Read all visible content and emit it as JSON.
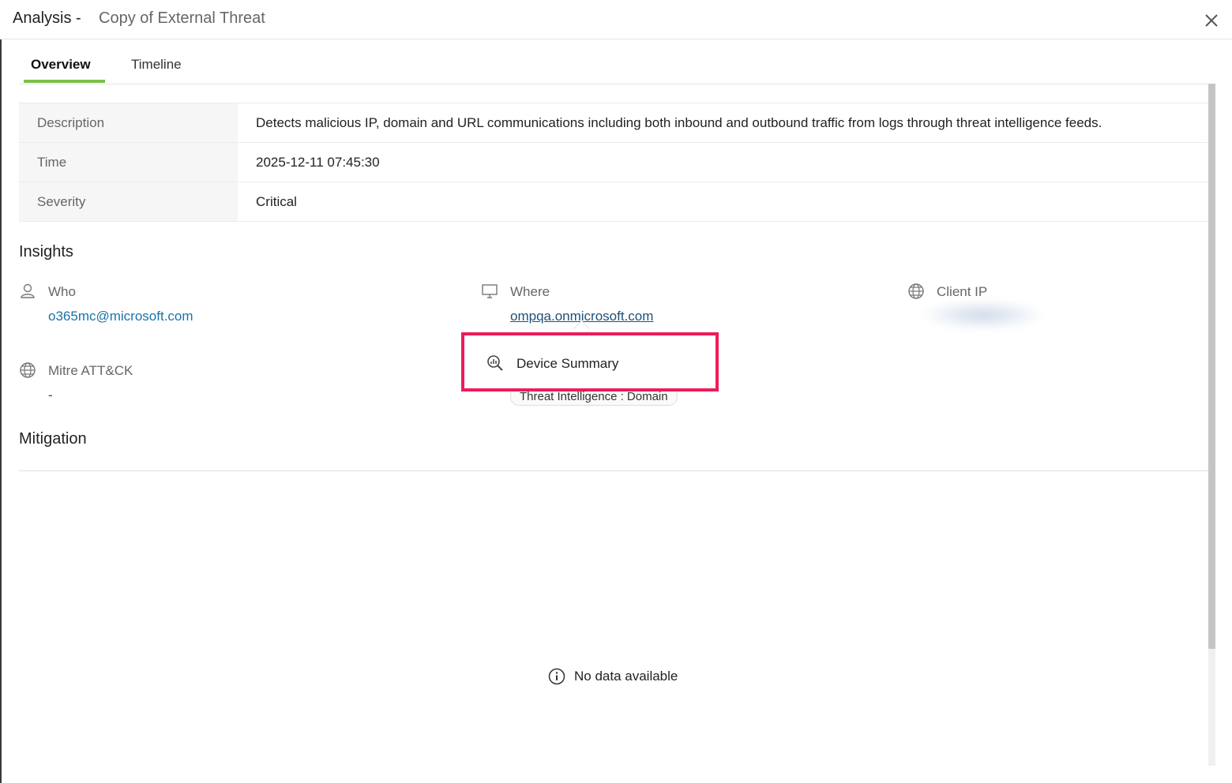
{
  "header": {
    "title": "Analysis -",
    "subtitle": "Copy of External Threat"
  },
  "tabs": [
    {
      "label": "Overview",
      "active": true
    },
    {
      "label": "Timeline",
      "active": false
    }
  ],
  "details": [
    {
      "key": "Description",
      "value": "Detects malicious IP, domain and URL communications including both inbound and outbound traffic from logs through threat intelligence feeds."
    },
    {
      "key": "Time",
      "value": "2025-12-11 07:45:30"
    },
    {
      "key": "Severity",
      "value": "Critical"
    }
  ],
  "insights": {
    "title": "Insights",
    "who": {
      "label": "Who",
      "value": "o365mc@microsoft.com",
      "icon": "user-icon"
    },
    "where": {
      "label": "Where",
      "value": "ompqa.onmicrosoft.com",
      "icon": "monitor-icon"
    },
    "client_ip": {
      "label": "Client IP",
      "icon": "globe-icon"
    },
    "mitre": {
      "label": "Mitre ATT&CK",
      "value": "-",
      "icon": "globe-icon"
    },
    "tag": "Threat Intelligence : Domain"
  },
  "popup": {
    "item_label": "Device Summary",
    "icon": "search-chart-icon",
    "highlight_color": "#ef1b5a"
  },
  "mitigation": {
    "title": "Mitigation",
    "empty_text": "No data available",
    "icon": "info-icon"
  },
  "colors": {
    "accent": "#7cbf4a",
    "link": "#1a73a8"
  }
}
